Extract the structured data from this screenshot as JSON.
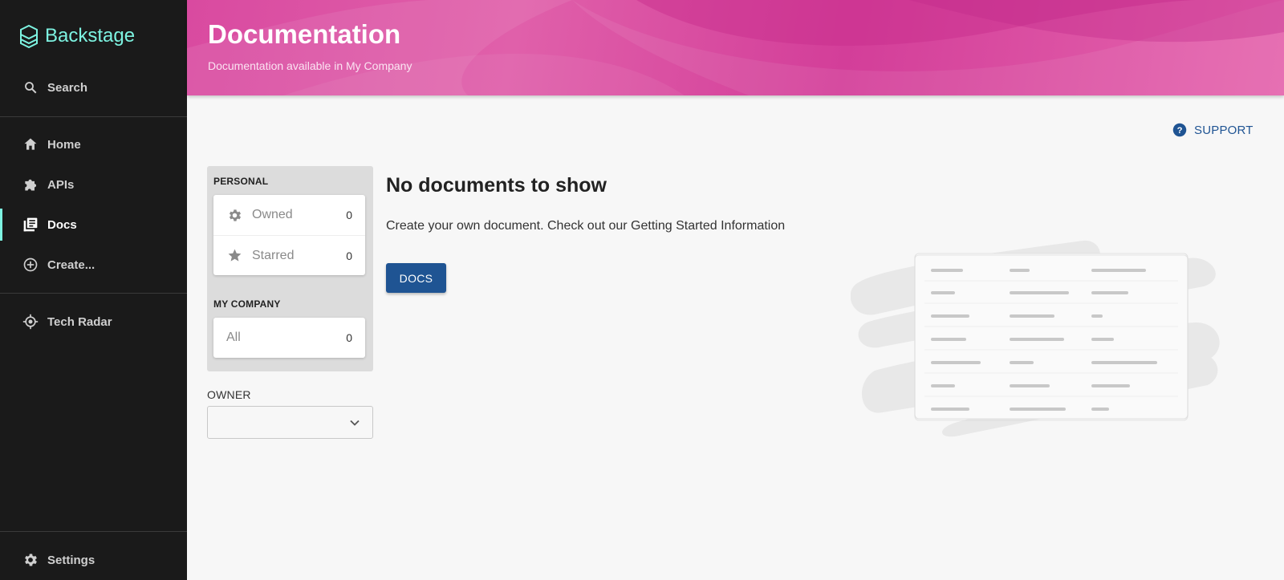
{
  "app": {
    "name": "Backstage"
  },
  "sidebar": {
    "search_label": "Search",
    "items": [
      {
        "label": "Home",
        "icon": "home-icon"
      },
      {
        "label": "APIs",
        "icon": "puzzle-icon"
      },
      {
        "label": "Docs",
        "icon": "docs-icon",
        "active": true
      },
      {
        "label": "Create...",
        "icon": "add-circle-icon"
      }
    ],
    "plugins": [
      {
        "label": "Tech Radar",
        "icon": "radar-icon"
      }
    ],
    "settings_label": "Settings"
  },
  "header": {
    "title": "Documentation",
    "subtitle": "Documentation available in My Company"
  },
  "support": {
    "label": "SUPPORT"
  },
  "filters": {
    "personal_heading": "PERSONAL",
    "personal": [
      {
        "label": "Owned",
        "count": "0",
        "icon": "gear-icon"
      },
      {
        "label": "Starred",
        "count": "0",
        "icon": "star-icon"
      }
    ],
    "company_heading": "MY COMPANY",
    "company": [
      {
        "label": "All",
        "count": "0"
      }
    ],
    "owner_label": "OWNER",
    "owner_value": ""
  },
  "empty_state": {
    "title": "No documents to show",
    "description": "Create your own document. Check out our Getting Started Information",
    "button_label": "DOCS"
  },
  "colors": {
    "sidebar_bg": "#1a1a1a",
    "brand_accent": "#7df3e1",
    "header_pink": "#d94aa0",
    "primary_blue": "#1f5493"
  }
}
